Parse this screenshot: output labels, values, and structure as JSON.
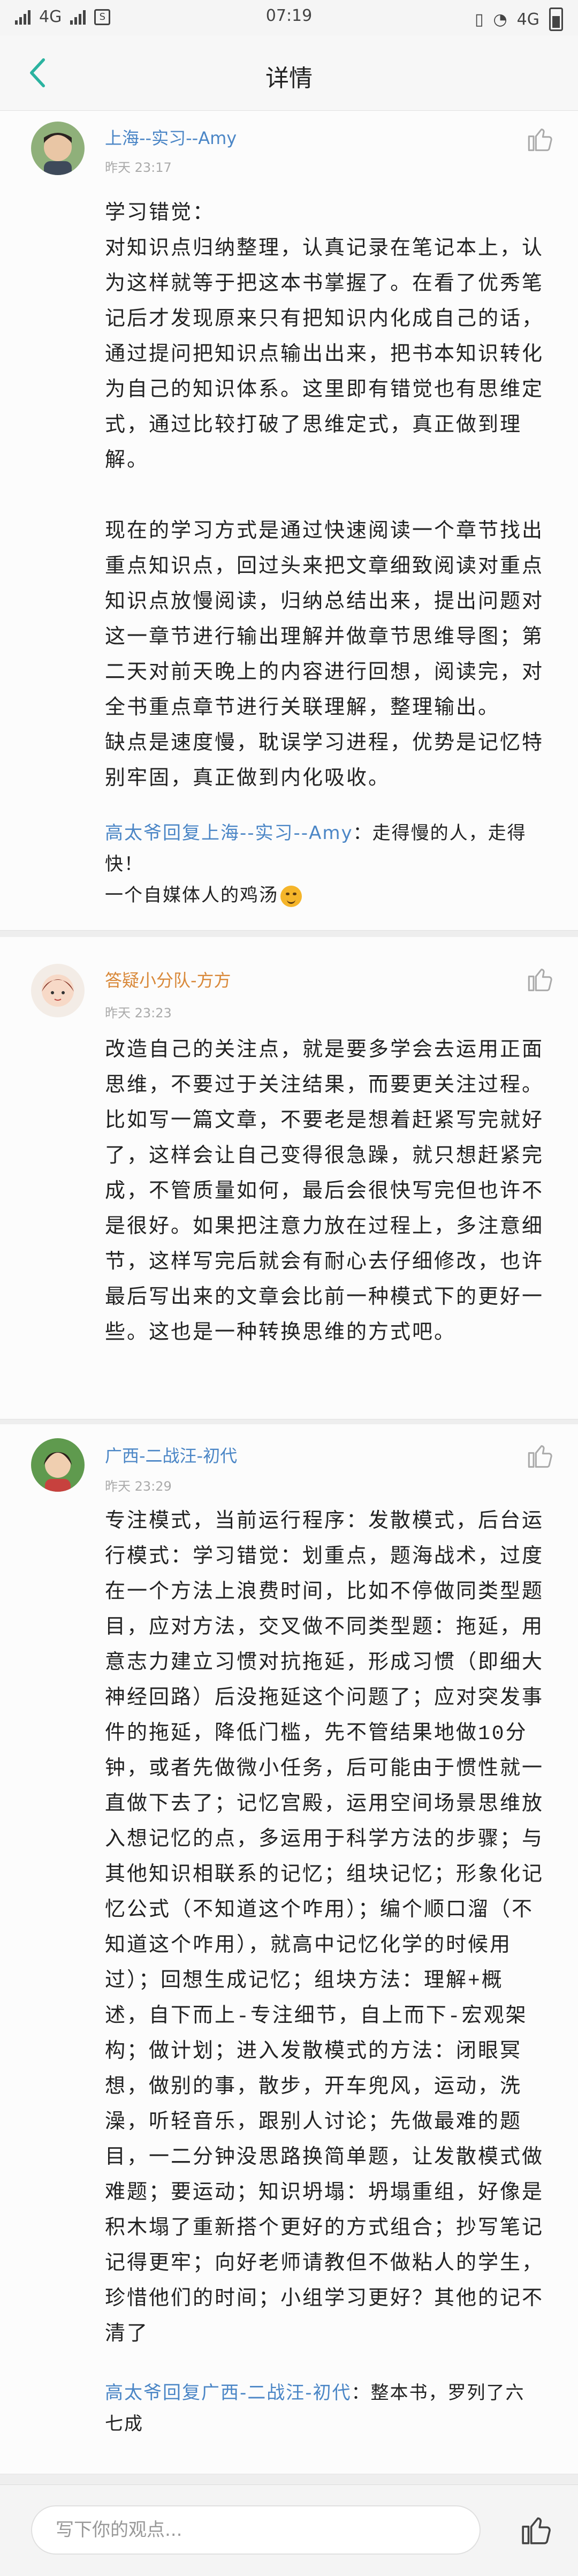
{
  "status_bar": {
    "carrier_left": "4G",
    "time": "07:19",
    "network_right": "4G"
  },
  "header": {
    "title": "详情"
  },
  "comments": [
    {
      "name": "上海--实习--Amy",
      "time": "昨天 23:17",
      "body": "学习错觉：\n对知识点归纳整理，认真记录在笔记本上，认为这样就等于把这本书掌握了。在看了优秀笔记后才发现原来只有把知识内化成自己的话，通过提问把知识点输出出来，把书本知识转化为自己的知识体系。这里即有错觉也有思维定式，通过比较打破了思维定式，真正做到理解。\n\n现在的学习方式是通过快速阅读一个章节找出重点知识点，回过头来把文章细致阅读对重点知识点放慢阅读，归纳总结出来，提出问题对这一章节进行输出理解并做章节思维导图；第二天对前天晚上的内容进行回想，阅读完，对全书重点章节进行关联理解，整理输出。\n缺点是速度慢，耽误学习进程，优势是记忆特别牢固，真正做到内化吸收。",
      "reply": {
        "from": "高太爷",
        "verb": "回复",
        "to": "上海--实习--Amy",
        "text": "：走得慢的人，走得快！\n一个自媒体人的鸡汤"
      }
    },
    {
      "name": "答疑小分队-方方",
      "time": "昨天 23:23",
      "body": "改造自己的关注点，就是要多学会去运用正面思维，不要过于关注结果，而要更关注过程。比如写一篇文章，不要老是想着赶紧写完就好了，这样会让自己变得很急躁，就只想赶紧完成，不管质量如何，最后会很快写完但也许不是很好。如果把注意力放在过程上，多注意细节，这样写完后就会有耐心去仔细修改，也许最后写出来的文章会比前一种模式下的更好一些。这也是一种转换思维的方式吧。"
    },
    {
      "name": "广西-二战汪-初代",
      "time": "昨天 23:29",
      "body": "专注模式，当前运行程序：发散模式，后台运行模式：学习错觉：划重点，题海战术，过度在一个方法上浪费时间，比如不停做同类型题目，应对方法，交叉做不同类型题：拖延，用意志力建立习惯对抗拖延，形成习惯（即细大神经回路）后没拖延这个问题了；应对突发事件的拖延，降低门槛，先不管结果地做10分钟，或者先做微小任务，后可能由于惯性就一直做下去了；记忆宫殿，运用空间场景思维放入想记忆的点，多运用于科学方法的步骤；与其他知识相联系的记忆；组块记忆；形象化记忆公式（不知道这个咋用）；编个顺口溜（不知道这个咋用），就高中记忆化学的时候用过）；回想生成记忆；组块方法：理解+概述，自下而上-专注细节，自上而下-宏观架构；做计划；进入发散模式的方法：闭眼冥想，做别的事，散步，开车兜风，运动，洗澡，听轻音乐，跟别人讨论；先做最难的题目，一二分钟没思路换简单题，让发散模式做难题；要运动；知识坍塌：坍塌重组，好像是积木塌了重新搭个更好的方式组合；抄写笔记记得更牢；向好老师请教但不做粘人的学生，珍惜他们的时间；小组学习更好？其他的记不清了",
      "reply": {
        "from": "高太爷",
        "verb": "回复",
        "to": "广西-二战汪-初代",
        "text": "：整本书，罗列了六七成"
      }
    }
  ],
  "bottom_bar": {
    "input_placeholder": "写下你的观点..."
  },
  "colors": {
    "accent": "#4b86c6",
    "back_arrow": "#2bb3a0",
    "name_orange": "#e08a3a"
  }
}
